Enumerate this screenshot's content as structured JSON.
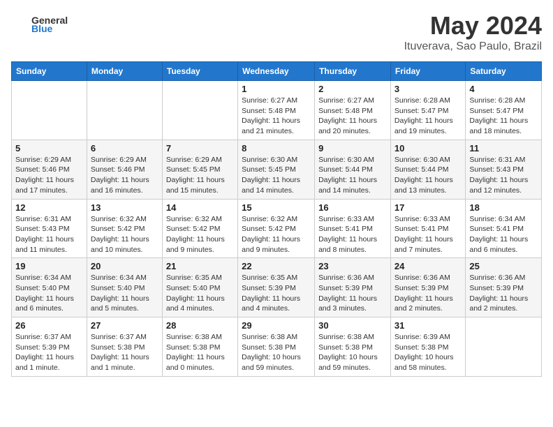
{
  "header": {
    "logo_general": "General",
    "logo_blue": "Blue",
    "month_year": "May 2024",
    "location": "Ituverava, Sao Paulo, Brazil"
  },
  "weekdays": [
    "Sunday",
    "Monday",
    "Tuesday",
    "Wednesday",
    "Thursday",
    "Friday",
    "Saturday"
  ],
  "weeks": [
    [
      {
        "day": "",
        "info": ""
      },
      {
        "day": "",
        "info": ""
      },
      {
        "day": "",
        "info": ""
      },
      {
        "day": "1",
        "info": "Sunrise: 6:27 AM\nSunset: 5:48 PM\nDaylight: 11 hours\nand 21 minutes."
      },
      {
        "day": "2",
        "info": "Sunrise: 6:27 AM\nSunset: 5:48 PM\nDaylight: 11 hours\nand 20 minutes."
      },
      {
        "day": "3",
        "info": "Sunrise: 6:28 AM\nSunset: 5:47 PM\nDaylight: 11 hours\nand 19 minutes."
      },
      {
        "day": "4",
        "info": "Sunrise: 6:28 AM\nSunset: 5:47 PM\nDaylight: 11 hours\nand 18 minutes."
      }
    ],
    [
      {
        "day": "5",
        "info": "Sunrise: 6:29 AM\nSunset: 5:46 PM\nDaylight: 11 hours\nand 17 minutes."
      },
      {
        "day": "6",
        "info": "Sunrise: 6:29 AM\nSunset: 5:46 PM\nDaylight: 11 hours\nand 16 minutes."
      },
      {
        "day": "7",
        "info": "Sunrise: 6:29 AM\nSunset: 5:45 PM\nDaylight: 11 hours\nand 15 minutes."
      },
      {
        "day": "8",
        "info": "Sunrise: 6:30 AM\nSunset: 5:45 PM\nDaylight: 11 hours\nand 14 minutes."
      },
      {
        "day": "9",
        "info": "Sunrise: 6:30 AM\nSunset: 5:44 PM\nDaylight: 11 hours\nand 14 minutes."
      },
      {
        "day": "10",
        "info": "Sunrise: 6:30 AM\nSunset: 5:44 PM\nDaylight: 11 hours\nand 13 minutes."
      },
      {
        "day": "11",
        "info": "Sunrise: 6:31 AM\nSunset: 5:43 PM\nDaylight: 11 hours\nand 12 minutes."
      }
    ],
    [
      {
        "day": "12",
        "info": "Sunrise: 6:31 AM\nSunset: 5:43 PM\nDaylight: 11 hours\nand 11 minutes."
      },
      {
        "day": "13",
        "info": "Sunrise: 6:32 AM\nSunset: 5:42 PM\nDaylight: 11 hours\nand 10 minutes."
      },
      {
        "day": "14",
        "info": "Sunrise: 6:32 AM\nSunset: 5:42 PM\nDaylight: 11 hours\nand 9 minutes."
      },
      {
        "day": "15",
        "info": "Sunrise: 6:32 AM\nSunset: 5:42 PM\nDaylight: 11 hours\nand 9 minutes."
      },
      {
        "day": "16",
        "info": "Sunrise: 6:33 AM\nSunset: 5:41 PM\nDaylight: 11 hours\nand 8 minutes."
      },
      {
        "day": "17",
        "info": "Sunrise: 6:33 AM\nSunset: 5:41 PM\nDaylight: 11 hours\nand 7 minutes."
      },
      {
        "day": "18",
        "info": "Sunrise: 6:34 AM\nSunset: 5:41 PM\nDaylight: 11 hours\nand 6 minutes."
      }
    ],
    [
      {
        "day": "19",
        "info": "Sunrise: 6:34 AM\nSunset: 5:40 PM\nDaylight: 11 hours\nand 6 minutes."
      },
      {
        "day": "20",
        "info": "Sunrise: 6:34 AM\nSunset: 5:40 PM\nDaylight: 11 hours\nand 5 minutes."
      },
      {
        "day": "21",
        "info": "Sunrise: 6:35 AM\nSunset: 5:40 PM\nDaylight: 11 hours\nand 4 minutes."
      },
      {
        "day": "22",
        "info": "Sunrise: 6:35 AM\nSunset: 5:39 PM\nDaylight: 11 hours\nand 4 minutes."
      },
      {
        "day": "23",
        "info": "Sunrise: 6:36 AM\nSunset: 5:39 PM\nDaylight: 11 hours\nand 3 minutes."
      },
      {
        "day": "24",
        "info": "Sunrise: 6:36 AM\nSunset: 5:39 PM\nDaylight: 11 hours\nand 2 minutes."
      },
      {
        "day": "25",
        "info": "Sunrise: 6:36 AM\nSunset: 5:39 PM\nDaylight: 11 hours\nand 2 minutes."
      }
    ],
    [
      {
        "day": "26",
        "info": "Sunrise: 6:37 AM\nSunset: 5:39 PM\nDaylight: 11 hours\nand 1 minute."
      },
      {
        "day": "27",
        "info": "Sunrise: 6:37 AM\nSunset: 5:38 PM\nDaylight: 11 hours\nand 1 minute."
      },
      {
        "day": "28",
        "info": "Sunrise: 6:38 AM\nSunset: 5:38 PM\nDaylight: 11 hours\nand 0 minutes."
      },
      {
        "day": "29",
        "info": "Sunrise: 6:38 AM\nSunset: 5:38 PM\nDaylight: 10 hours\nand 59 minutes."
      },
      {
        "day": "30",
        "info": "Sunrise: 6:38 AM\nSunset: 5:38 PM\nDaylight: 10 hours\nand 59 minutes."
      },
      {
        "day": "31",
        "info": "Sunrise: 6:39 AM\nSunset: 5:38 PM\nDaylight: 10 hours\nand 58 minutes."
      },
      {
        "day": "",
        "info": ""
      }
    ]
  ]
}
